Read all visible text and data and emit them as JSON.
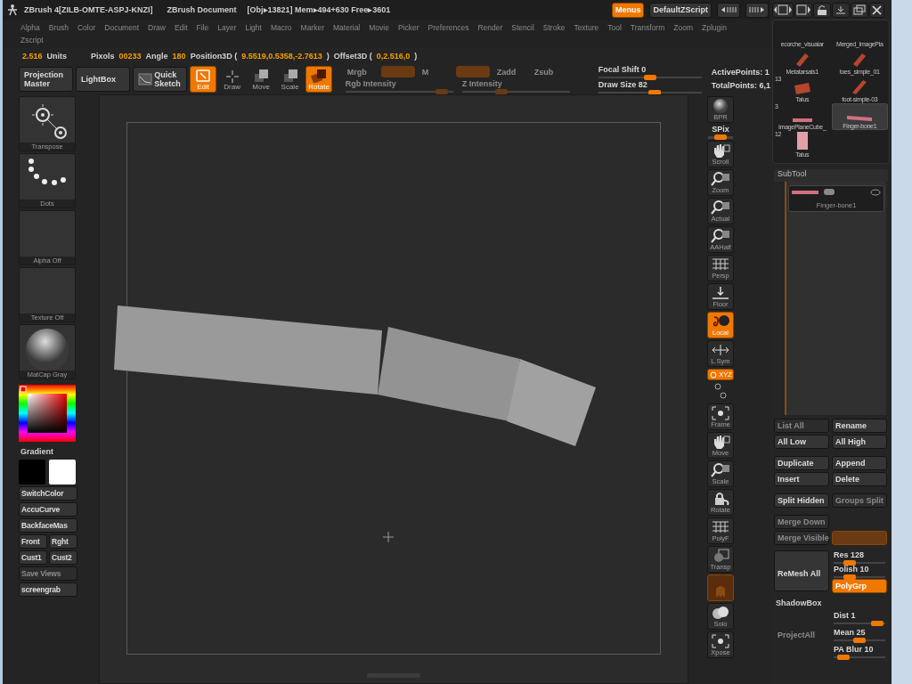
{
  "title_bar": {
    "app": "ZBrush 4[ZILB-OMTE-ASPJ-KNZI]",
    "document": "ZBrush Document",
    "stats": "[Obj▸13821] Mem▸494+630 Free▸3601",
    "menus": {
      "label": "Menus",
      "selected": true
    },
    "script": "DefaultZScript"
  },
  "menu_bar": [
    "Alpha",
    "Brush",
    "Color",
    "Document",
    "Draw",
    "Edit",
    "File",
    "Layer",
    "Light",
    "Macro",
    "Marker",
    "Material",
    "Movie",
    "Picker",
    "Preferences",
    "Render",
    "Stencil",
    "Stroke",
    "Texture",
    "Tool",
    "Transform",
    "Zoom",
    "Zplugin",
    "Zscript"
  ],
  "info_bar": {
    "units_value": "2.516",
    "units_label": "Units",
    "items": [
      {
        "label": "Pixols",
        "value": "00233"
      },
      {
        "label": "Angle",
        "value": "180"
      },
      {
        "label": "Position3D (",
        "value": "9.5519,0.5358,-2.7613",
        "suffix": ")"
      },
      {
        "label": "Offset3D (",
        "value": "0,2.516,0",
        "suffix": ")"
      }
    ]
  },
  "toolbar": {
    "buttons": [
      "Projection Master",
      "LightBox",
      "Quick Sketch"
    ],
    "modes": [
      {
        "label": "Edit",
        "kind": "edit",
        "selected": true
      },
      {
        "label": "Draw",
        "kind": "draw",
        "selected": false
      },
      {
        "label": "Move",
        "kind": "move",
        "selected": false
      },
      {
        "label": "Scale",
        "kind": "scale",
        "selected": false
      },
      {
        "label": "Rotate",
        "kind": "rotate",
        "selected": true
      }
    ],
    "channel_buttons": [
      {
        "label": "Mrgb",
        "on": false
      },
      {
        "on": true
      },
      {
        "label": "M",
        "on": false
      },
      {
        "on": true
      },
      {
        "label": "Zadd",
        "on": false
      },
      {
        "label": "Zsub",
        "on": false
      }
    ],
    "sliders": [
      {
        "label": "Rgb Intensity",
        "level": 0.95,
        "disabled": true
      },
      {
        "label": "Z Intensity",
        "level": 0.35,
        "disabled": true
      },
      {
        "label": "Focal Shift 0",
        "level": 0.5,
        "disabled": false
      },
      {
        "label": "Draw Size 82",
        "level": 0.55,
        "disabled": false
      }
    ],
    "stats": [
      "ActivePoints: 1",
      "TotalPoints: 6,1"
    ]
  },
  "left_shelf": {
    "tiles": [
      {
        "kind": "transpose",
        "label": "Transpose"
      },
      {
        "kind": "dots",
        "label": "Dots"
      },
      {
        "kind": "empty",
        "label": "Alpha Off"
      },
      {
        "kind": "empty",
        "label": "Texture Off"
      },
      {
        "kind": "sphere",
        "label": "MatCap Gray"
      }
    ],
    "gradient_label": "Gradient",
    "button_rows": [
      [
        {
          "label": "SwitchColor",
          "disabled": false
        }
      ],
      [
        {
          "label": "AccuCurve",
          "disabled": false
        }
      ],
      [
        {
          "label": "BackfaceMas",
          "disabled": false
        }
      ],
      [
        {
          "label": "Front",
          "disabled": false
        },
        {
          "label": "Rght",
          "disabled": false
        }
      ],
      [
        {
          "label": "Cust1",
          "disabled": false
        },
        {
          "label": "Cust2",
          "disabled": false
        }
      ],
      [
        {
          "label": "Save Views",
          "disabled": true
        }
      ],
      [
        {
          "label": "screengrab",
          "disabled": false
        }
      ]
    ]
  },
  "right_shelf": [
    {
      "label": "BPR",
      "kind": "sphere",
      "on": false
    },
    {
      "label": "SPix",
      "kind": "slider",
      "level": 0.5
    },
    {
      "label": "Scroll",
      "kind": "hand",
      "on": false
    },
    {
      "label": "Zoom",
      "kind": "magnifier",
      "on": false
    },
    {
      "label": "Actual",
      "kind": "magnifier",
      "on": false
    },
    {
      "label": "AAHalf",
      "kind": "magnifier",
      "on": false
    },
    {
      "label": "Persp",
      "kind": "grid",
      "on": false
    },
    {
      "label": "Floor",
      "kind": "floor",
      "on": false
    },
    {
      "label": "Local",
      "kind": "local",
      "on": true
    },
    {
      "label": "L.Sym",
      "kind": "sym",
      "on": false
    },
    {
      "label": "XYZ",
      "kind": "xyz",
      "on": true
    },
    {
      "kind": "axes"
    },
    {
      "label": "Frame",
      "kind": "frame",
      "on": false
    },
    {
      "label": "Move",
      "kind": "hand",
      "on": false
    },
    {
      "label": "Scale",
      "kind": "magnifier",
      "on": false
    },
    {
      "label": "Rotate",
      "kind": "rotate",
      "on": false
    },
    {
      "label": "PolyF",
      "kind": "grid",
      "on": false
    },
    {
      "label": "Transp",
      "kind": "transp",
      "on": false
    },
    {
      "kind": "ghost",
      "on": true
    },
    {
      "label": "Solo",
      "kind": "solo",
      "on": false
    },
    {
      "label": "Xpose",
      "kind": "frame",
      "on": false
    }
  ],
  "tool_thumbnails": [
    {
      "label": "ecorche_visualar",
      "selected": false
    },
    {
      "label": "Merged_ImagePla",
      "selected": false
    },
    {
      "label": "Metatarsals1",
      "selected": false
    },
    {
      "label": "toes_simple_01",
      "selected": false
    },
    {
      "label": "Talus",
      "count": "13",
      "selected": false
    },
    {
      "label": "foot-simple-03",
      "selected": false
    },
    {
      "label": "ImagePlaneCube_",
      "count": "3",
      "selected": false
    },
    {
      "label": "Finger-bone1",
      "selected": true
    },
    {
      "label": "Talus",
      "count": "12",
      "selected": false
    }
  ],
  "subtool": {
    "title": "SubTool",
    "items": [
      {
        "label": "Finger-bone1",
        "selected": true
      }
    ],
    "button_rows": [
      [
        {
          "label": "List All",
          "disabled": true
        },
        {
          "label": "Rename",
          "disabled": false
        }
      ],
      [
        {
          "label": "All Low",
          "disabled": false
        },
        {
          "label": "All High",
          "disabled": false
        }
      ],
      [
        {
          "label": "Duplicate",
          "disabled": false
        },
        {
          "label": "Append",
          "disabled": false
        }
      ],
      [
        {
          "label": "Insert",
          "disabled": false
        },
        {
          "label": "Delete",
          "disabled": false
        }
      ],
      [
        {
          "label": "Split Hidden",
          "disabled": false
        },
        {
          "label": "Groups Split",
          "disabled": true
        }
      ],
      [
        {
          "label": "Merge Down",
          "disabled": true
        }
      ],
      [
        {
          "label": "Merge Visible",
          "disabled": true
        },
        {
          "disabled": true,
          "on": true
        }
      ]
    ],
    "remesh": {
      "label": "ReMesh All",
      "sliders": [
        {
          "label": "Res 128",
          "level": 0.25
        },
        {
          "label": "Polish 10",
          "level": 0.25
        }
      ],
      "toggle": {
        "label": "PolyGrp",
        "on": true
      }
    },
    "shadowbox_label": "ShadowBox",
    "project": {
      "label": "ProjectAll",
      "disabled": true,
      "sliders": [
        {
          "label": "Dist 1",
          "level": 0.95
        },
        {
          "label": "Mean 25",
          "level": 0.5
        },
        {
          "label": "PA Blur 10",
          "level": 0.1
        }
      ]
    }
  }
}
